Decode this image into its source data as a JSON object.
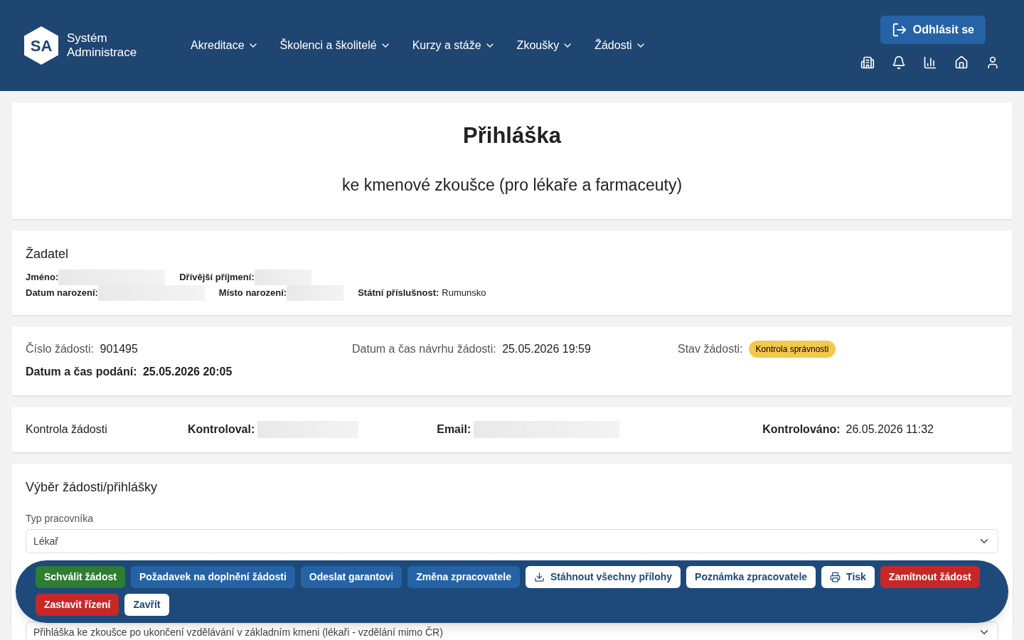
{
  "header": {
    "logo": {
      "mark": "SA",
      "line_1": "Systém",
      "line_2": "Administrace"
    },
    "nav": [
      {
        "label": "Akreditace"
      },
      {
        "label": "Školenci a školitelé"
      },
      {
        "label": "Kurzy a stáže"
      },
      {
        "label": "Zkoušky"
      },
      {
        "label": "Žádosti"
      }
    ],
    "logout_button": "Odhlásit se"
  },
  "title_card": {
    "title": "Přihláška",
    "subtitle": "ke kmenové zkoušce (pro lékaře a farmaceuty)"
  },
  "applicant": {
    "heading": "Žadatel",
    "rows": [
      [
        {
          "label": "Jméno:"
        },
        {
          "label": "Dřívější příjmení:"
        }
      ],
      [
        {
          "label": "Datum narození:"
        },
        {
          "label": "Místo narození:"
        },
        {
          "label": "Státní příslušnost:",
          "value": "Rumunsko"
        }
      ]
    ]
  },
  "request": {
    "number_label": "Číslo žádosti:",
    "number": "901495",
    "draft_label": "Datum a čas návrhu žádosti:",
    "draft": "25.05.2026 19:59",
    "status_label": "Stav žádosti:",
    "status": "Kontrola správnosti",
    "submitted_label": "Datum a čas podání:",
    "submitted": "25.05.2026 20:05"
  },
  "check": {
    "title": "Kontrola žádosti",
    "checked_by_label": "Kontroloval:",
    "email_label": "Email:",
    "checked_at_label": "Kontrolováno:",
    "checked_at": "26.05.2026 11:32"
  },
  "selection": {
    "heading": "Výběr žádosti/přihlášky",
    "worker_type_label": "Typ pracovníka",
    "worker_type": "Lékař",
    "application_type": "Přihláška ke zkoušce po ukončení vzdělávání v základním kmeni (lékaři - vzdělání mimo ČR)"
  },
  "actions": [
    {
      "label": "Schválit žádost",
      "kind": "success"
    },
    {
      "label": "Požadavek na doplnění žádosti",
      "kind": "primary"
    },
    {
      "label": "Odeslat garantovi",
      "kind": "primary"
    },
    {
      "label": "Změna zpracovatele",
      "kind": "primary"
    },
    {
      "label": "Stáhnout všechny přílohy",
      "kind": "download"
    },
    {
      "label": "Poznámka zpracovatele",
      "kind": "outline"
    },
    {
      "label": "Tisk",
      "kind": "print"
    },
    {
      "label": "Zamítnout žádost",
      "kind": "danger"
    },
    {
      "label": "Zastavit řízení",
      "kind": "danger"
    },
    {
      "label": "Zavřít",
      "kind": "outline"
    }
  ]
}
